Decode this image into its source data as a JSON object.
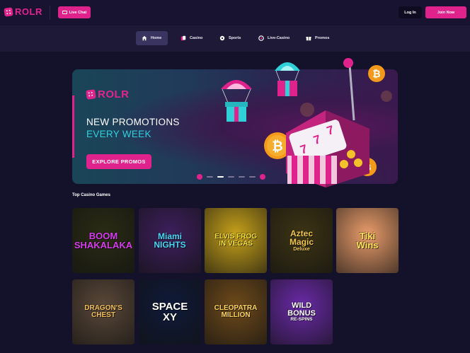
{
  "header": {
    "logo_text": "ROLR",
    "live_chat_label": "Live Chat",
    "login_label": "Log In",
    "join_label": "Join Now"
  },
  "nav": {
    "items": [
      {
        "label": "Home",
        "icon": "home-icon",
        "active": true
      },
      {
        "label": "Casino",
        "icon": "cards-icon",
        "active": false
      },
      {
        "label": "Sports",
        "icon": "soccer-ball-icon",
        "active": false
      },
      {
        "label": "Live-Casino",
        "icon": "chip-icon",
        "active": false
      },
      {
        "label": "Promos",
        "icon": "gift-icon",
        "active": false
      }
    ]
  },
  "banner": {
    "logo_text": "ROLR",
    "line1": "NEW PROMOTIONS",
    "line2": "EVERY WEEK",
    "cta": "EXPLORE PROMOS",
    "slide_index": 2,
    "slide_count": 5
  },
  "games": {
    "section_title": "Top Casino Games",
    "items": [
      {
        "title_line1": "BOOM",
        "title_line2": "SHAKALAKA",
        "bg": "#2a2c14",
        "fg": "#d63cf0"
      },
      {
        "title_line1": "Miami",
        "title_line2": "NIGHTS",
        "bg": "#3d1f5c",
        "fg": "#49d7f5"
      },
      {
        "title_line1": "ELVIS FROG",
        "title_line2": "IN VEGAS",
        "bg": "#c6a11a",
        "fg": "#f6e03c"
      },
      {
        "title_line1": "Aztec",
        "title_line2": "Magic",
        "title_line3": "Deluxe",
        "bg": "#3d3414",
        "fg": "#f0c64a"
      },
      {
        "title_line1": "Tiki",
        "title_line2": "Wins",
        "bg": "#e99c6a",
        "fg": "#ffe35a"
      },
      {
        "title_line1": "DRAGON'S",
        "title_line2": "CHEST",
        "bg": "#5a4838",
        "fg": "#f2c05a"
      },
      {
        "title_line1": "SPACE",
        "title_line2": "XY",
        "bg": "#0f1a3a",
        "fg": "#ffffff"
      },
      {
        "title_line1": "CLEOPATRA",
        "title_line2": "MILLION",
        "bg": "#6e4a1a",
        "fg": "#ffd660"
      },
      {
        "title_line1": "WILD",
        "title_line2": "BONUS",
        "title_line3": "RE-SPINS",
        "bg": "#6a2aa8",
        "fg": "#ffffff"
      }
    ]
  },
  "colors": {
    "brand_pink": "#e0228d",
    "accent_cyan": "#2ed0e0",
    "bitcoin_orange": "#f39a1b"
  }
}
